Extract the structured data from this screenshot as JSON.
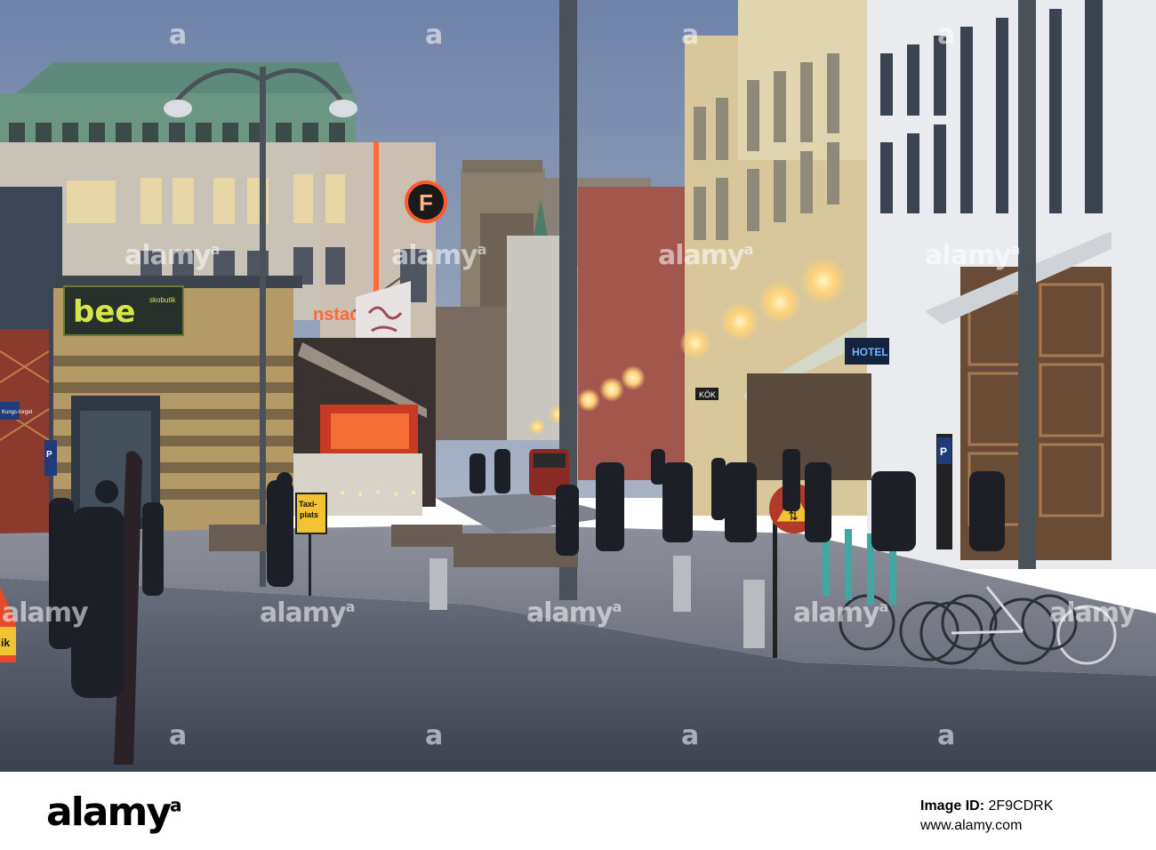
{
  "signs": {
    "bee": "bee",
    "bee_small": "skobutik",
    "f_logo": "F",
    "nstad": "nstad",
    "taxi_line1": "Taxi-",
    "taxi_line2": "plats",
    "hotel": "HOTEL",
    "kok": "KÖK",
    "street_sign": "Kungs-torget",
    "p_sign_left": "P",
    "p_sign_right": "P",
    "edge_sign_left": "ik"
  },
  "watermark": {
    "text": "alamy",
    "mark": "a"
  },
  "footer": {
    "logo": "alamy",
    "logo_mark": "a",
    "image_id_label": "Image ID:",
    "image_id": "2F9CDRK",
    "url": "www.alamy.com"
  },
  "colors": {
    "sky": "#7b8fb3",
    "street": "#4a4f5e",
    "lights": "#ffd27a",
    "neon": "#ff5a2a"
  }
}
